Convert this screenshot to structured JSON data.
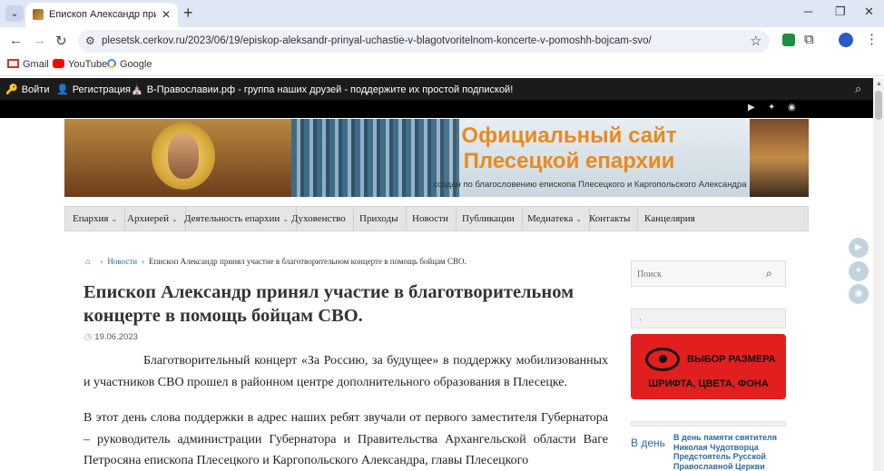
{
  "browser": {
    "tab_title": "Епископ Александр принял уч",
    "tab_close": "✕",
    "new_tab": "+",
    "url": "plesetsk.cerkov.ru/2023/06/19/episkop-aleksandr-prinyal-uchastie-v-blagotvoritelnom-koncerte-v-pomoshh-bojcam-svo/",
    "bookmarks": [
      "Gmail",
      "YouTube",
      "Google"
    ]
  },
  "topbar": {
    "login": "Войти",
    "register": "Регистрация",
    "promo": "В-Православии.рф - группа наших друзей - поддержите их простой подпиской!"
  },
  "banner": {
    "title_line1": "Официальный сайт",
    "title_line2": "Плесецкой епархии",
    "subtitle": "создан по благословению епископа Плесецкого и Каргопольского Александра"
  },
  "nav": {
    "items": [
      "Епархия",
      "Архиерей",
      "Деятельность епархии",
      "Духовенство",
      "Приходы",
      "Новости",
      "Публикации",
      "Медиатека",
      "Контакты",
      "Канцелярия"
    ]
  },
  "breadcrumb": {
    "news": "Новости",
    "current": "Епископ Александр принял участие в благотворительном концерте в помощь бойцам СВО."
  },
  "article": {
    "title": "Епископ Александр принял участие в благотворительном концерте в помощь бойцам СВО.",
    "date": "19.06.2023",
    "p1": "Благотворительный концерт «За Россию, за будущее» в поддержку мобилизованных и участников СВО прошел в районном центре дополнительного образования в Плесецке.",
    "p2": "В этот день слова поддержки в адрес наших ребят звучали от первого заместителя Губернатора – руководитель администрации Губернатора и Правительства Архангельской области Ваге Петросяна епископа Плесецкого и Каргопольского Александра, главы Плесецкого"
  },
  "sidebar": {
    "search_placeholder": "Поиск",
    "box_text": ".",
    "a11y_line1": "ВЫБОР РАЗМЕРА",
    "a11y_line2": "ШРИФТА, ЦВЕТА, ФОНА",
    "news_img_alt": "В день",
    "news_title": "В день памяти святителя Николая Чудотворца Предстоятель Русской Православной Церкви"
  },
  "colors": {
    "accent_orange": "#e98a1d",
    "link_blue": "#2b6aa6",
    "a11y_red": "#e21f1f"
  }
}
